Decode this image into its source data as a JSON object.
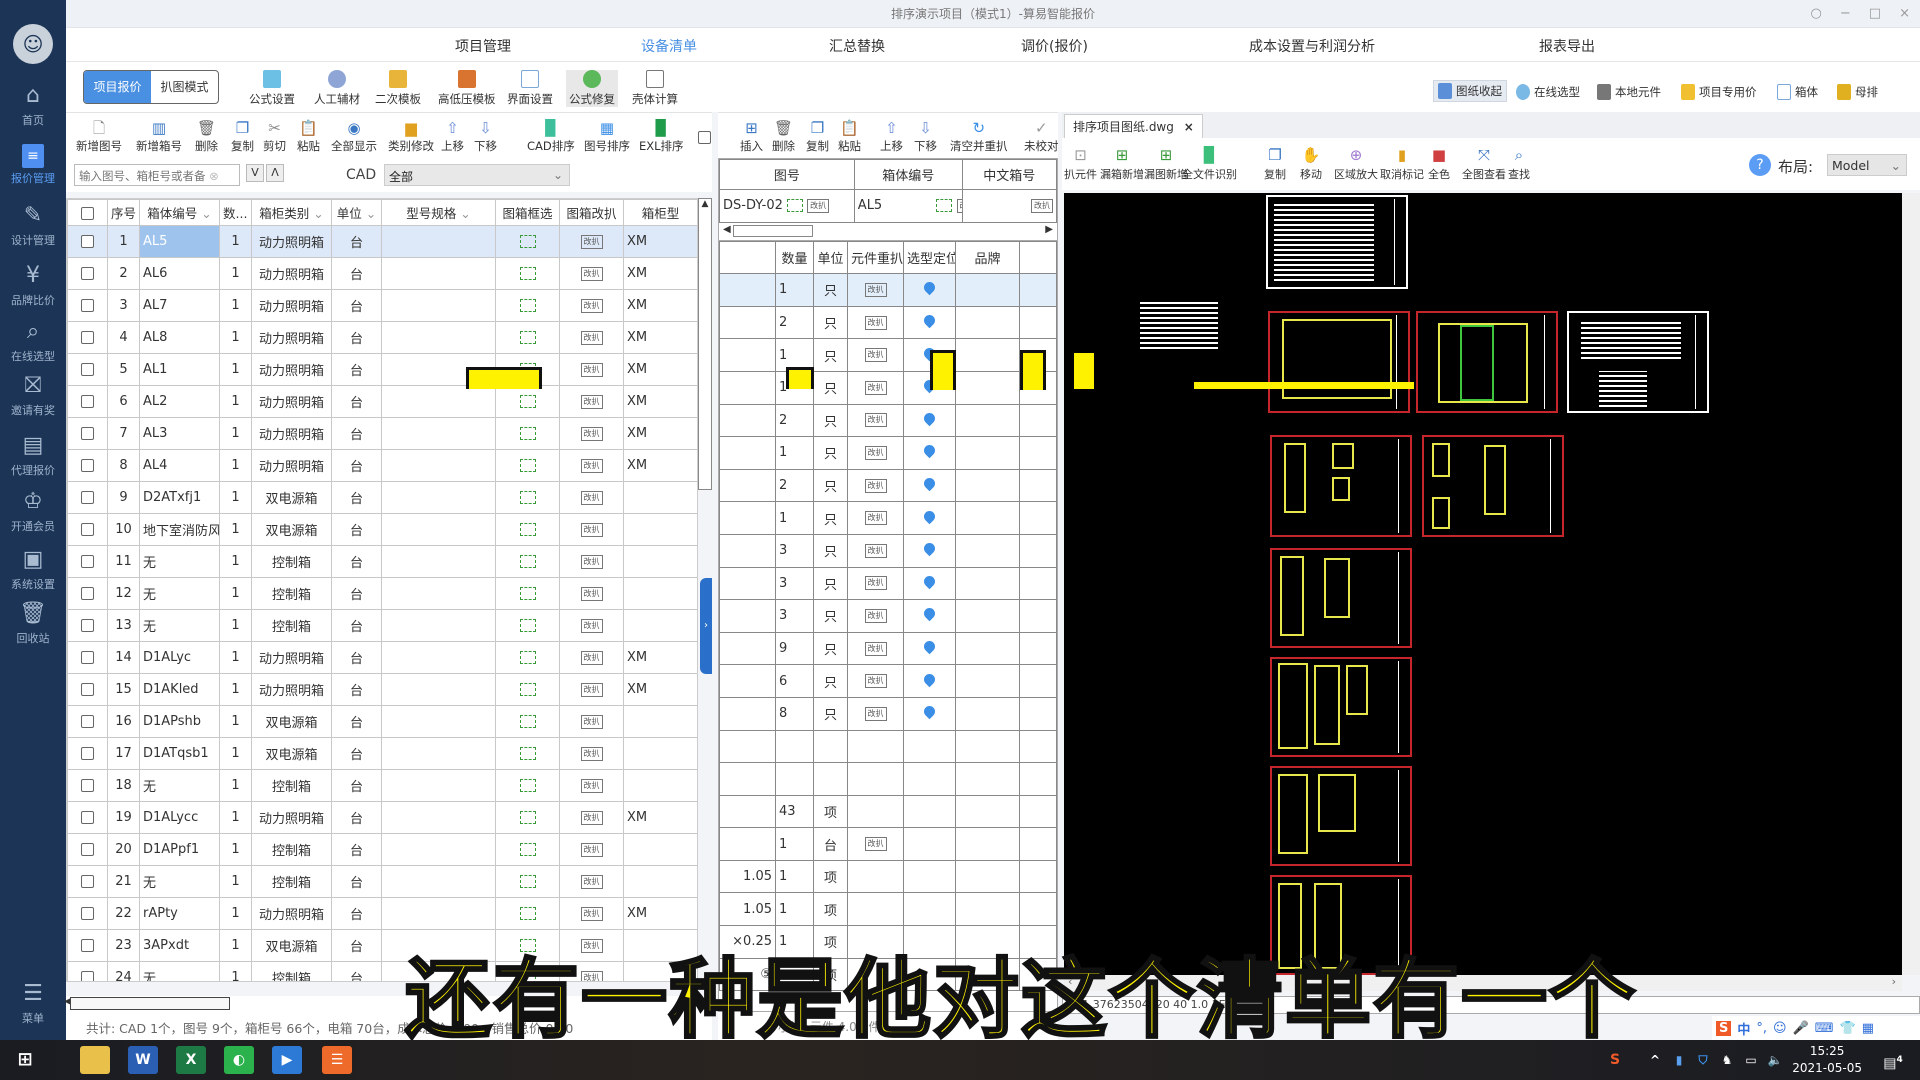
{
  "window": {
    "title": "排序演示项目（模式1）-算易智能报价",
    "controls": [
      "○",
      "−",
      "□",
      "×"
    ]
  },
  "sidebar": {
    "items": [
      {
        "label": "首页",
        "icon": "home-icon"
      },
      {
        "label": "报价管理",
        "icon": "quote-doc-icon",
        "active": true
      },
      {
        "label": "设计管理",
        "icon": "design-pen-icon"
      },
      {
        "label": "品牌比价",
        "icon": "price-compare-icon"
      },
      {
        "label": "在线选型",
        "icon": "search-icon"
      },
      {
        "label": "邀请有奖",
        "icon": "gift-icon"
      },
      {
        "label": "代理报价",
        "icon": "agent-quote-icon"
      },
      {
        "label": "开通会员",
        "icon": "crown-icon"
      },
      {
        "label": "系统设置",
        "icon": "settings-icon"
      },
      {
        "label": "回收站",
        "icon": "trash-icon"
      },
      {
        "label": "菜单",
        "icon": "menu-icon"
      }
    ]
  },
  "topnav": {
    "tabs": [
      {
        "label": "项目管理"
      },
      {
        "label": "设备清单",
        "active": true
      },
      {
        "label": "汇总替换"
      },
      {
        "label": "调价(报价)"
      },
      {
        "label": "成本设置与利润分析"
      },
      {
        "label": "报表导出"
      }
    ]
  },
  "ribbon": {
    "modes": [
      "项目报价",
      "扒图模式"
    ],
    "buttons": [
      "公式设置",
      "人工辅材",
      "二次模板",
      "高低压模板",
      "界面设置",
      "公式修复",
      "壳体计算"
    ],
    "right_buttons": [
      "图纸收起",
      "在线选型",
      "本地元件",
      "项目专用价",
      "箱体",
      "母排"
    ]
  },
  "left_toolbar": {
    "buttons": [
      "新增图号",
      "新增箱号",
      "删除",
      "复制",
      "剪切",
      "粘贴",
      "全部显示",
      "类别修改",
      "上移",
      "下移",
      "CAD排序",
      "图号排序",
      "EXL排序"
    ]
  },
  "search": {
    "placeholder": "输入图号、箱柜号或者备",
    "down_label": "V",
    "up_label": "Λ",
    "cad_label": "CAD",
    "cad_value": "全部"
  },
  "left_table": {
    "columns": [
      "",
      "序号",
      "箱体编号",
      "数...",
      "箱柜类别",
      "单位",
      "型号规格",
      "图箱框选",
      "图箱改扒",
      "箱柜型"
    ],
    "edit_label": "改扒",
    "rows": [
      {
        "no": "1",
        "code": "AL5",
        "qty": "1",
        "type": "动力照明箱",
        "unit": "台",
        "spec": "",
        "model": "XM"
      },
      {
        "no": "2",
        "code": "AL6",
        "qty": "1",
        "type": "动力照明箱",
        "unit": "台",
        "spec": "",
        "model": "XM"
      },
      {
        "no": "3",
        "code": "AL7",
        "qty": "1",
        "type": "动力照明箱",
        "unit": "台",
        "spec": "",
        "model": "XM"
      },
      {
        "no": "4",
        "code": "AL8",
        "qty": "1",
        "type": "动力照明箱",
        "unit": "台",
        "spec": "",
        "model": "XM"
      },
      {
        "no": "5",
        "code": "AL1",
        "qty": "1",
        "type": "动力照明箱",
        "unit": "台",
        "spec": "",
        "model": "XM"
      },
      {
        "no": "6",
        "code": "AL2",
        "qty": "1",
        "type": "动力照明箱",
        "unit": "台",
        "spec": "",
        "model": "XM"
      },
      {
        "no": "7",
        "code": "AL3",
        "qty": "1",
        "type": "动力照明箱",
        "unit": "台",
        "spec": "",
        "model": "XM"
      },
      {
        "no": "8",
        "code": "AL4",
        "qty": "1",
        "type": "动力照明箱",
        "unit": "台",
        "spec": "",
        "model": "XM"
      },
      {
        "no": "9",
        "code": "D2ATxfj1",
        "qty": "1",
        "type": "双电源箱",
        "unit": "台",
        "spec": "",
        "model": ""
      },
      {
        "no": "10",
        "code": "地下室消防风",
        "qty": "1",
        "type": "双电源箱",
        "unit": "台",
        "spec": "",
        "model": ""
      },
      {
        "no": "11",
        "code": "无",
        "qty": "1",
        "type": "控制箱",
        "unit": "台",
        "spec": "",
        "model": ""
      },
      {
        "no": "12",
        "code": "无",
        "qty": "1",
        "type": "控制箱",
        "unit": "台",
        "spec": "",
        "model": ""
      },
      {
        "no": "13",
        "code": "无",
        "qty": "1",
        "type": "控制箱",
        "unit": "台",
        "spec": "",
        "model": ""
      },
      {
        "no": "14",
        "code": "D1ALyc",
        "qty": "1",
        "type": "动力照明箱",
        "unit": "台",
        "spec": "",
        "model": "XM"
      },
      {
        "no": "15",
        "code": "D1AKled",
        "qty": "1",
        "type": "动力照明箱",
        "unit": "台",
        "spec": "",
        "model": "XM"
      },
      {
        "no": "16",
        "code": "D1APshb",
        "qty": "1",
        "type": "双电源箱",
        "unit": "台",
        "spec": "",
        "model": ""
      },
      {
        "no": "17",
        "code": "D1ATqsb1",
        "qty": "1",
        "type": "双电源箱",
        "unit": "台",
        "spec": "",
        "model": ""
      },
      {
        "no": "18",
        "code": "无",
        "qty": "1",
        "type": "控制箱",
        "unit": "台",
        "spec": "",
        "model": ""
      },
      {
        "no": "19",
        "code": "D1ALycc",
        "qty": "1",
        "type": "动力照明箱",
        "unit": "台",
        "spec": "",
        "model": "XM"
      },
      {
        "no": "20",
        "code": "D1APpf1",
        "qty": "1",
        "type": "控制箱",
        "unit": "台",
        "spec": "",
        "model": ""
      },
      {
        "no": "21",
        "code": "无",
        "qty": "1",
        "type": "控制箱",
        "unit": "台",
        "spec": "",
        "model": ""
      },
      {
        "no": "22",
        "code": "rAPty",
        "qty": "1",
        "type": "动力照明箱",
        "unit": "台",
        "spec": "",
        "model": "XM"
      },
      {
        "no": "23",
        "code": "3APxdt",
        "qty": "1",
        "type": "双电源箱",
        "unit": "台",
        "spec": "",
        "model": ""
      },
      {
        "no": "24",
        "code": "无",
        "qty": "1",
        "type": "控制箱",
        "unit": "台",
        "spec": "",
        "model": ""
      }
    ],
    "status": "共计: CAD 1个，图号 9个，箱柜号 66个，电箱 70台，成本总价 0.00，销售总价 0.00"
  },
  "middle_toolbar": {
    "buttons": [
      "插入",
      "删除",
      "复制",
      "粘贴",
      "上移",
      "下移",
      "清空并重扒",
      "未校对"
    ]
  },
  "middle_panel": {
    "header_cols": [
      "图号",
      "箱体编号",
      "中文箱号"
    ],
    "drawing_no": "DS-DY-02",
    "box_no": "AL5",
    "edit_label": "改扒",
    "columns": [
      "",
      "数量",
      "单位",
      "元件重扒",
      "选型定位",
      "品牌"
    ],
    "rows": [
      {
        "left": "",
        "qty": "1",
        "unit": "只",
        "rescan": true,
        "locate": true
      },
      {
        "left": "",
        "qty": "2",
        "unit": "只",
        "rescan": true,
        "locate": true
      },
      {
        "left": "",
        "qty": "1",
        "unit": "只",
        "rescan": true,
        "locate": true
      },
      {
        "left": "",
        "qty": "1",
        "unit": "只",
        "rescan": true,
        "locate": true
      },
      {
        "left": "",
        "qty": "2",
        "unit": "只",
        "rescan": true,
        "locate": true
      },
      {
        "left": "",
        "qty": "1",
        "unit": "只",
        "rescan": true,
        "locate": true
      },
      {
        "left": "",
        "qty": "2",
        "unit": "只",
        "rescan": true,
        "locate": true
      },
      {
        "left": "",
        "qty": "1",
        "unit": "只",
        "rescan": true,
        "locate": true
      },
      {
        "left": "",
        "qty": "3",
        "unit": "只",
        "rescan": true,
        "locate": true
      },
      {
        "left": "",
        "qty": "3",
        "unit": "只",
        "rescan": true,
        "locate": true
      },
      {
        "left": "",
        "qty": "3",
        "unit": "只",
        "rescan": true,
        "locate": true
      },
      {
        "left": "",
        "qty": "9",
        "unit": "只",
        "rescan": true,
        "locate": true
      },
      {
        "left": "",
        "qty": "6",
        "unit": "只",
        "rescan": true,
        "locate": true
      },
      {
        "left": "",
        "qty": "8",
        "unit": "只",
        "rescan": true,
        "locate": true
      },
      {
        "left": "",
        "qty": "",
        "unit": "",
        "rescan": false,
        "locate": false
      },
      {
        "left": "",
        "qty": "",
        "unit": "",
        "rescan": false,
        "locate": false
      },
      {
        "left": "",
        "qty": "43",
        "unit": "项",
        "rescan": false,
        "locate": false
      },
      {
        "left": "",
        "qty": "1",
        "unit": "台",
        "rescan": true,
        "locate": false
      },
      {
        "left": "1.05",
        "qty": "1",
        "unit": "项",
        "rescan": false,
        "locate": false
      },
      {
        "left": "1.05",
        "qty": "1",
        "unit": "项",
        "rescan": false,
        "locate": false
      },
      {
        "left": "×0.25",
        "qty": "1",
        "unit": "项",
        "rescan": false,
        "locate": false
      },
      {
        "left": "⑤",
        "qty": "",
        "unit": "项",
        "rescan": false,
        "locate": false
      }
    ],
    "status": "小计: 元件 4.00 件"
  },
  "right_panel": {
    "file_tab": "排序项目图纸.dwg",
    "tools": [
      "扒元件",
      "漏箱新增",
      "漏图新增",
      "全文件识别",
      "复制",
      "移动",
      "区域放大",
      "取消标记",
      "全色",
      "全图查看",
      "查找"
    ],
    "layout_label": "布局:",
    "layout_value": "Model",
    "coord_text": "X:-1.37623504620  40 1.0 1E 5"
  },
  "caption": "还有一种是他对这个清单有一个",
  "taskbar": {
    "apps": [
      "file-explorer",
      "word",
      "excel",
      "wechat",
      "video-recorder",
      "suanyi-app"
    ],
    "time": "15:25",
    "date": "2021-05-05",
    "notifications": "4"
  },
  "ime": {
    "label": "中"
  }
}
